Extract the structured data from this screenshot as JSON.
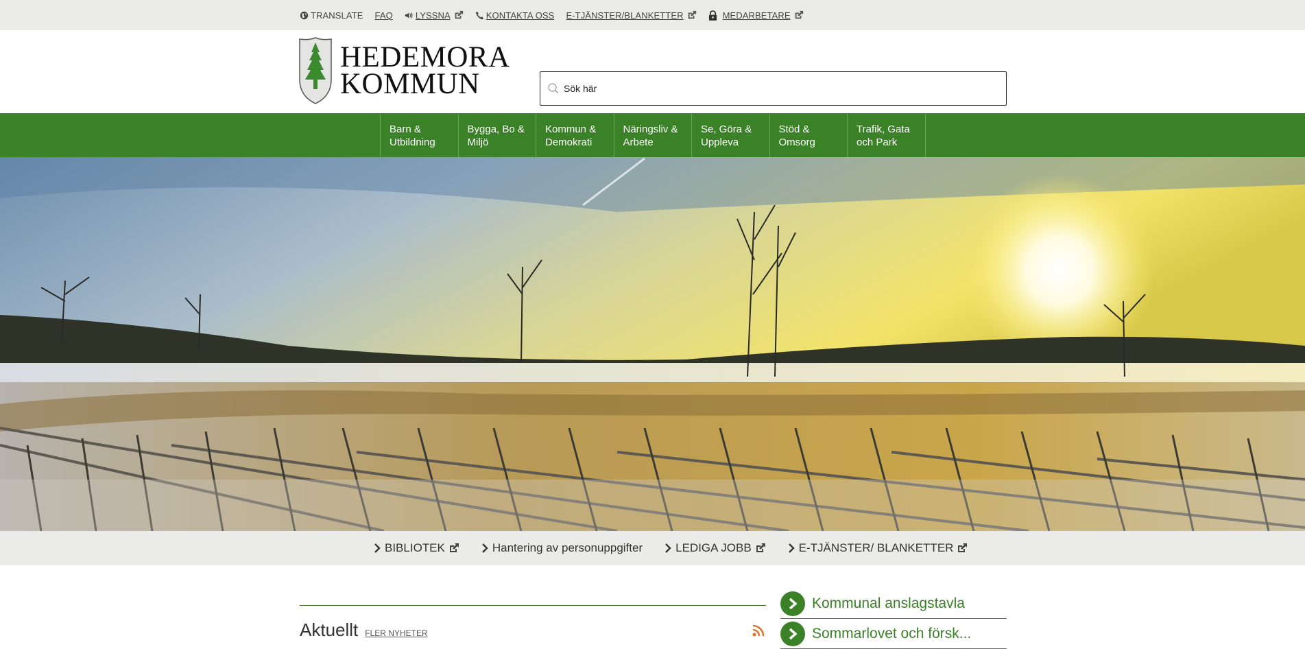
{
  "topbar": {
    "items": [
      {
        "label": "TRANSLATE",
        "icon": "globe-icon"
      },
      {
        "label": "FAQ",
        "icon": ""
      },
      {
        "label": "LYSSNA",
        "icon": "speaker-icon",
        "external": true
      },
      {
        "label": "KONTAKTA OSS",
        "icon": "phone-icon"
      },
      {
        "label": "E-TJÄNSTER/BLANKETTER",
        "icon": "",
        "external": true
      },
      {
        "label": "MEDARBETARE",
        "icon": "lock-icon",
        "external": true
      }
    ]
  },
  "logo": {
    "line1": "HEDEMORA",
    "line2": "KOMMUN"
  },
  "search": {
    "placeholder": "Sök här"
  },
  "mainnav": {
    "items": [
      {
        "line1": "Barn &",
        "line2": "Utbildning"
      },
      {
        "line1": "Bygga, Bo &",
        "line2": "Miljö"
      },
      {
        "line1": "Kommun &",
        "line2": "Demokrati"
      },
      {
        "line1": "Näringsliv &",
        "line2": "Arbete"
      },
      {
        "line1": "Se, Göra &",
        "line2": "Uppleva"
      },
      {
        "line1": "Stöd &",
        "line2": "Omsorg"
      },
      {
        "line1": "Trafik, Gata",
        "line2": "och Park"
      }
    ]
  },
  "quicklinks": {
    "items": [
      {
        "label": "BIBLIOTEK",
        "external": true
      },
      {
        "label": "Hantering av personuppgifter",
        "external": false
      },
      {
        "label": "LEDIGA JOBB",
        "external": true
      },
      {
        "label": "E-TJÄNSTER/ BLANKETTER",
        "external": true
      }
    ]
  },
  "news": {
    "title": "Aktuellt",
    "more": "FLER NYHETER"
  },
  "side": {
    "items": [
      {
        "label": "Kommunal anslagstavla"
      },
      {
        "label": "Sommarlovet och försk..."
      }
    ]
  },
  "colors": {
    "brand_green": "#3a8127",
    "topbar_bg": "#ebebe9"
  }
}
